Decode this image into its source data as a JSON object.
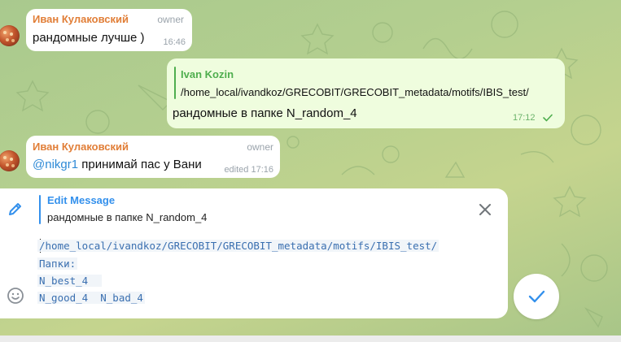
{
  "theme": {
    "accent": "#3390ec",
    "sender_color": "#e17e37",
    "reply_color": "#4fae4e",
    "outgoing_bubble": "#effdde"
  },
  "messages": [
    {
      "sender": "Иван Кулаковский",
      "role": "owner",
      "text": "рандомные лучше )",
      "time": "16:46"
    },
    {
      "reply_to_name": "Ivan Kozin",
      "reply_to_text": "/home_local/ivandkoz/GRECOBIT/GRECOBIT_metadata/motifs/IBIS_test/",
      "text": "рандомные в папке N_random_4",
      "time": "17:12",
      "status_icon": "check-icon"
    },
    {
      "sender": "Иван Кулаковский",
      "role": "owner",
      "mention": "@nikgr1",
      "text": " принимай пас у Вани",
      "time": "edited 17:16"
    }
  ],
  "compose": {
    "edit_title": "Edit Message",
    "edit_original": "рандомные в папке N_random_4",
    "lines": [
      "/home_local/ivandkoz/GRECOBIT/GRECOBIT_metadata/motifs/IBIS_test/",
      "Папки:",
      "N_best_4  ",
      "N_good_4  N_bad_4"
    ],
    "icons": {
      "edit": "pencil-icon",
      "close": "close-icon",
      "emoji": "emoji-icon",
      "send": "check-icon"
    }
  }
}
